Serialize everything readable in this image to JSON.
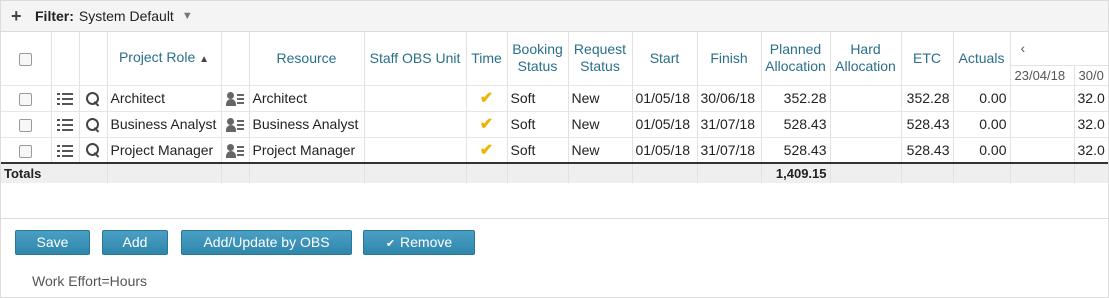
{
  "filter": {
    "label": "Filter:",
    "value": "System Default"
  },
  "columns": {
    "project_role": "Project Role",
    "resource": "Resource",
    "staff_obs_unit": "Staff OBS Unit",
    "time": "Time",
    "booking_status": "Booking Status",
    "request_status": "Request Status",
    "start": "Start",
    "finish": "Finish",
    "planned_allocation": "Planned Allocation",
    "hard_allocation": "Hard Allocation",
    "etc": "ETC",
    "actuals": "Actuals",
    "dates": [
      "23/04/18",
      "30/0"
    ]
  },
  "rows": [
    {
      "role": "Architect",
      "resource": "Architect",
      "staff_obs": "",
      "booking": "Soft",
      "request": "New",
      "start": "01/05/18",
      "finish": "30/06/18",
      "planned": "352.28",
      "hard": "",
      "etc": "352.28",
      "actuals": "0.00",
      "d1": "",
      "d2": "32.0"
    },
    {
      "role": "Business Analyst",
      "resource": "Business Analyst",
      "staff_obs": "",
      "booking": "Soft",
      "request": "New",
      "start": "01/05/18",
      "finish": "31/07/18",
      "planned": "528.43",
      "hard": "",
      "etc": "528.43",
      "actuals": "0.00",
      "d1": "",
      "d2": "32.0"
    },
    {
      "role": "Project Manager",
      "resource": "Project Manager",
      "staff_obs": "",
      "booking": "Soft",
      "request": "New",
      "start": "01/05/18",
      "finish": "31/07/18",
      "planned": "528.43",
      "hard": "",
      "etc": "528.43",
      "actuals": "0.00",
      "d1": "",
      "d2": "32.0"
    }
  ],
  "totals": {
    "label": "Totals",
    "planned": "1,409.15"
  },
  "buttons": {
    "save": "Save",
    "add": "Add",
    "add_update_obs": "Add/Update by OBS",
    "remove": "Remove"
  },
  "footer": {
    "note": "Work Effort=Hours"
  },
  "colors": {
    "accent": "#2f86ab",
    "header_text": "#2a6f8a",
    "check": "#f0b400"
  }
}
